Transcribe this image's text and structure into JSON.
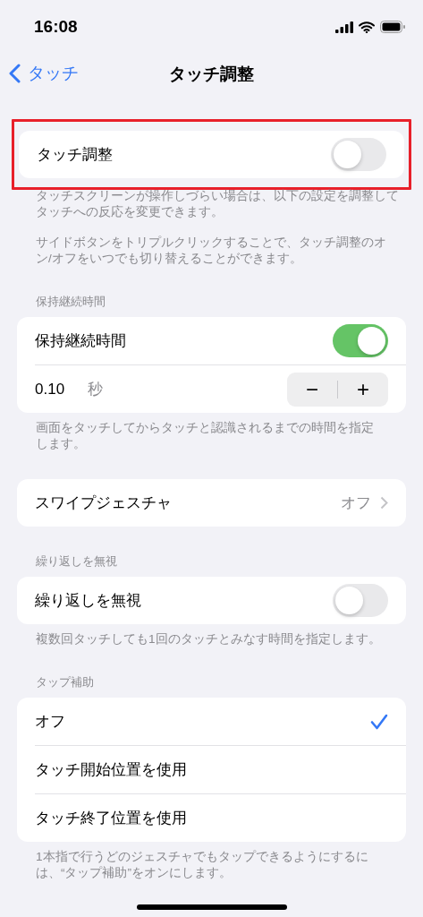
{
  "status_bar": {
    "time": "16:08"
  },
  "nav": {
    "back": "タッチ",
    "title": "タッチ調整"
  },
  "sections": [
    {
      "highlighted": true,
      "rows": [
        {
          "kind": "toggle",
          "label": "タッチ調整",
          "on": false
        }
      ],
      "footer": [
        [
          "タッチスクリーンが操作しづらい場合は、以下の設定を調整して",
          "タッチへの反応を変更できます。"
        ],
        [
          "サイドボタンをトリプルクリックすることで、タッチ調整のオ",
          "ン/オフをいつでも切り替えることができます。"
        ]
      ]
    },
    {
      "header": "保持継続時間",
      "rows": [
        {
          "kind": "toggle",
          "label": "保持継続時間",
          "on": true
        },
        {
          "kind": "stepper",
          "value": "0.10",
          "unit": "秒",
          "minus": "−",
          "plus": "+"
        }
      ],
      "footer": [
        [
          "画面をタッチしてからタッチと認識されるまでの時間を指定",
          "します。"
        ]
      ]
    },
    {
      "rows": [
        {
          "kind": "link",
          "label": "スワイプジェスチャ",
          "value": "オフ"
        }
      ]
    },
    {
      "header": "繰り返しを無視",
      "rows": [
        {
          "kind": "toggle",
          "label": "繰り返しを無視",
          "on": false
        }
      ],
      "footer": [
        [
          "複数回タッチしても1回のタッチとみなす時間を指定します。"
        ]
      ]
    },
    {
      "header": "タップ補助",
      "rows": [
        {
          "kind": "choice",
          "label": "オフ",
          "selected": true
        },
        {
          "kind": "choice",
          "label": "タッチ開始位置を使用",
          "selected": false
        },
        {
          "kind": "choice",
          "label": "タッチ終了位置を使用",
          "selected": false
        }
      ],
      "footer": [
        [
          "1本指で行うどのジェスチャでもタップできるようにするに",
          "は、“タップ補助”をオンにします。"
        ]
      ]
    }
  ]
}
